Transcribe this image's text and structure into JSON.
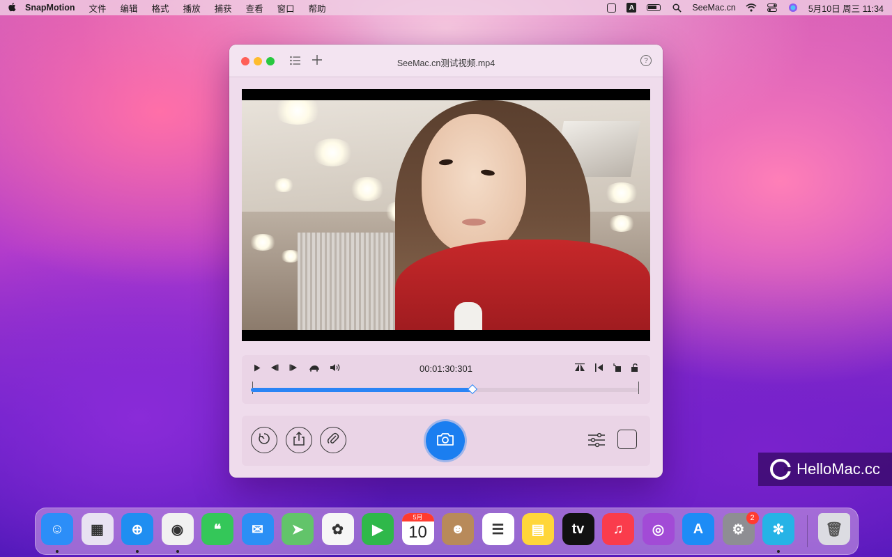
{
  "menubar": {
    "app_name": "SnapMotion",
    "items": [
      "文件",
      "编辑",
      "格式",
      "播放",
      "捕获",
      "查看",
      "窗口",
      "帮助"
    ],
    "site": "SeeMac.cn",
    "datetime": "5月10日 周三  11:34",
    "status_icons": [
      "screen-record-icon",
      "input-source-a-icon",
      "battery-charging-icon",
      "spotlight-search-icon",
      "wifi-icon",
      "control-center-icon",
      "siri-icon"
    ]
  },
  "window": {
    "title": "SeeMac.cn测试视频.mp4",
    "toolbar_icons": [
      "close",
      "minimize",
      "zoom",
      "list-icon",
      "add-icon",
      "help-icon"
    ],
    "help_glyph": "?",
    "playback": {
      "timecode": "00:01:30:301",
      "progress": 0.57,
      "left_controls": [
        "play-icon",
        "step-back-icon",
        "step-forward-icon",
        "speed-turtle-icon",
        "volume-icon"
      ],
      "right_controls": [
        "flip-icon",
        "trim-start-icon",
        "crop-icon",
        "lock-icon"
      ]
    },
    "actions": {
      "left_buttons": [
        "timer-icon",
        "share-icon",
        "attach-icon"
      ],
      "capture": "camera-icon",
      "right_buttons": [
        "adjustments-icon",
        "square-frame-icon"
      ]
    }
  },
  "watermark": {
    "text": "HelloMac.cc"
  },
  "dock": {
    "apps": [
      {
        "name": "finder",
        "color": "#2c8ef8",
        "glyph": "☺",
        "running": true
      },
      {
        "name": "launchpad",
        "color": "#e8e2f2",
        "glyph": "▦",
        "running": false
      },
      {
        "name": "safari",
        "color": "#1f8ef1",
        "glyph": "⊕",
        "running": true
      },
      {
        "name": "chrome",
        "color": "#f1f1f1",
        "glyph": "◉",
        "running": true
      },
      {
        "name": "messages",
        "color": "#34c759",
        "glyph": "❝",
        "running": false
      },
      {
        "name": "mail",
        "color": "#2b8ff5",
        "glyph": "✉",
        "running": false
      },
      {
        "name": "maps",
        "color": "#62c46a",
        "glyph": "➤",
        "running": false
      },
      {
        "name": "photos",
        "color": "#f6f6f6",
        "glyph": "✿",
        "running": false
      },
      {
        "name": "facetime",
        "color": "#2fb84a",
        "glyph": "▶",
        "running": false
      },
      {
        "name": "calendar",
        "color": "#ffffff",
        "glyph": "10",
        "label": "5月",
        "running": false
      },
      {
        "name": "contacts",
        "color": "#b88a5a",
        "glyph": "☻",
        "running": false
      },
      {
        "name": "reminders",
        "color": "#ffffff",
        "glyph": "☰",
        "running": false
      },
      {
        "name": "notes",
        "color": "#ffd63a",
        "glyph": "▤",
        "running": false
      },
      {
        "name": "apple-tv",
        "color": "#111111",
        "glyph": "tv",
        "running": false
      },
      {
        "name": "music",
        "color": "#fa3c4c",
        "glyph": "♫",
        "running": false
      },
      {
        "name": "podcasts",
        "color": "#a24bd6",
        "glyph": "◎",
        "running": false
      },
      {
        "name": "app-store",
        "color": "#1d8cf6",
        "glyph": "A",
        "running": false
      },
      {
        "name": "system-settings",
        "color": "#8e8e93",
        "glyph": "⚙",
        "badge": "2",
        "running": false
      },
      {
        "name": "snapmotion",
        "color": "#26b3e6",
        "glyph": "✻",
        "running": true
      }
    ],
    "trash": {
      "name": "trash",
      "color": "#dcdce2",
      "glyph": "🗑"
    }
  },
  "colors": {
    "accent": "#2a84f5",
    "capture_button": "#1b7ef0"
  }
}
